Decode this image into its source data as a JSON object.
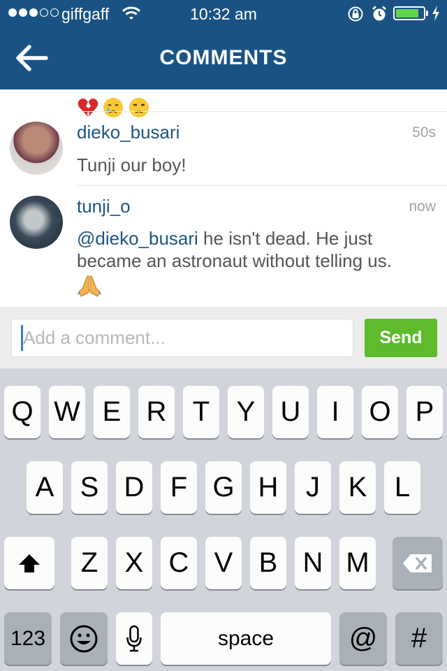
{
  "status_bar": {
    "carrier": "giffgaff",
    "time": "10:32 am",
    "battery_level": 0.85
  },
  "header": {
    "title": "COMMENTS",
    "back_icon": "arrow-left-icon"
  },
  "comments": [
    {
      "username": "dieko_busari",
      "time": "50s",
      "text": "Tunji our boy!"
    },
    {
      "username": "tunji_o",
      "time": "now",
      "mention": "@dieko_busari",
      "text": " he isn't dead. He just became an astronaut without telling us."
    }
  ],
  "comment_box": {
    "placeholder": "Add a comment...",
    "send_label": "Send"
  },
  "keyboard": {
    "row1": [
      "Q",
      "W",
      "E",
      "R",
      "T",
      "Y",
      "U",
      "I",
      "O",
      "P"
    ],
    "row2": [
      "A",
      "S",
      "D",
      "F",
      "G",
      "H",
      "J",
      "K",
      "L"
    ],
    "row3": [
      "Z",
      "X",
      "C",
      "V",
      "B",
      "N",
      "M"
    ],
    "numbers_label": "123",
    "space_label": "space",
    "at_label": "@",
    "hash_label": "#"
  },
  "colors": {
    "header": "#1a5383",
    "username": "#1c5583",
    "send": "#5dbb2c",
    "keyboard_bg": "#d1d5db"
  }
}
